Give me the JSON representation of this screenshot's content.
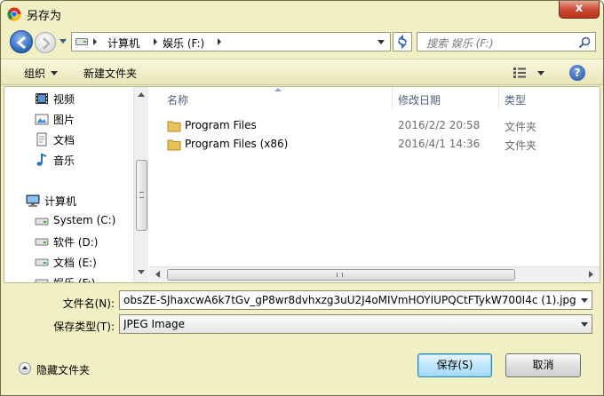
{
  "window": {
    "title": "另存为",
    "close_label": "x"
  },
  "address_bar": {
    "parts": [
      "计算机",
      "娱乐 (F:)"
    ]
  },
  "search": {
    "placeholder": "搜索 娱乐 (F:)"
  },
  "toolbar": {
    "organize_label": "组织",
    "new_folder_label": "新建文件夹",
    "help_label": "?"
  },
  "nav_pane": {
    "libraries": [
      {
        "label": "视频",
        "icon": "video-icon"
      },
      {
        "label": "图片",
        "icon": "pictures-icon"
      },
      {
        "label": "文档",
        "icon": "documents-icon"
      },
      {
        "label": "音乐",
        "icon": "music-icon"
      }
    ],
    "computer_label": "计算机",
    "drives": [
      {
        "label": "System (C:)",
        "icon": "drive-icon"
      },
      {
        "label": "软件 (D:)",
        "icon": "drive-icon"
      },
      {
        "label": "文档 (E:)",
        "icon": "drive-icon"
      },
      {
        "label": "娱乐 (F:)",
        "icon": "drive-icon"
      }
    ]
  },
  "file_list": {
    "columns": {
      "name": "名称",
      "modified": "修改日期",
      "type": "类型"
    },
    "rows": [
      {
        "name": "Program Files",
        "modified": "2016/2/2 20:58",
        "type": "文件夹"
      },
      {
        "name": "Program Files (x86)",
        "modified": "2016/4/1 14:36",
        "type": "文件夹"
      }
    ]
  },
  "save_form": {
    "filename_label": "文件名(N):",
    "filename_value": "obsZE-SJhaxcwA6k7tGv_gP8wr8dvhxzg3uU2J4oMIVmHOYIUPQCtFTykW700I4c (1).jpg",
    "filetype_label": "保存类型(T):",
    "filetype_value": "JPEG Image"
  },
  "footer": {
    "hide_folders_label": "隐藏文件夹",
    "save_label": "保存(S)",
    "cancel_label": "取消"
  },
  "colors": {
    "frame": "#f1f0c4",
    "close_button": "#c8452e",
    "primary_button": "#bee6fd",
    "folder": "#e8c15a"
  }
}
